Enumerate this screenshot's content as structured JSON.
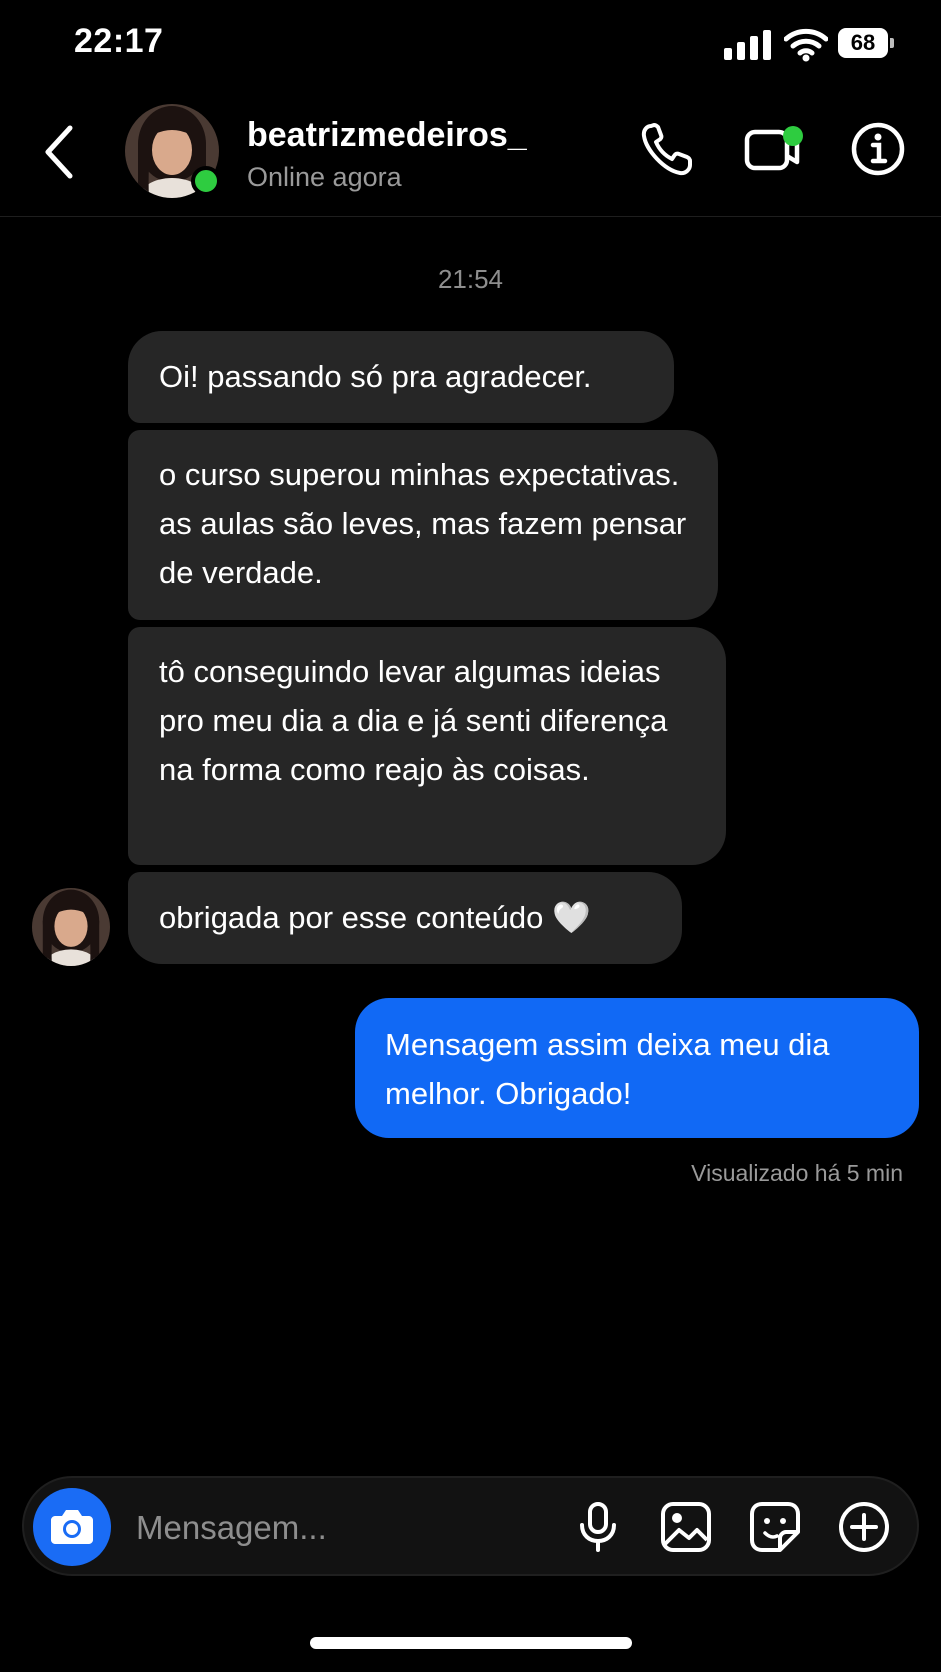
{
  "status_bar": {
    "time": "22:17",
    "battery": "68"
  },
  "header": {
    "username": "beatrizmedeiros_",
    "status": "Online agora",
    "icons": [
      "back-chevron-icon",
      "phone-icon",
      "video-call-icon",
      "info-icon"
    ]
  },
  "chat": {
    "timestamp": "21:54",
    "incoming": [
      {
        "text": "Oi! passando só pra agradecer."
      },
      {
        "text": "o curso superou minhas expectativas. as aulas são leves, mas fazem pensar de verdade."
      },
      {
        "text": "tô conseguindo levar algumas ideias pro meu dia a dia e já senti diferença na forma como reajo às coisas."
      },
      {
        "text": "obrigada por esse conteúdo 🤍"
      }
    ],
    "outgoing": [
      {
        "text": "Mensagem assim deixa meu dia melhor. Obrigado!"
      }
    ],
    "seen": "Visualizado há 5 min"
  },
  "composer": {
    "placeholder": "Mensagem...",
    "icons": [
      "camera-icon",
      "microphone-icon",
      "gallery-icon",
      "sticker-icon",
      "add-icon"
    ]
  },
  "colors": {
    "background": "#000000",
    "incoming_bubble": "#262626",
    "outgoing_bubble": "#1169f5",
    "online": "#2ecc40",
    "camera_button": "#1a6cf5"
  }
}
